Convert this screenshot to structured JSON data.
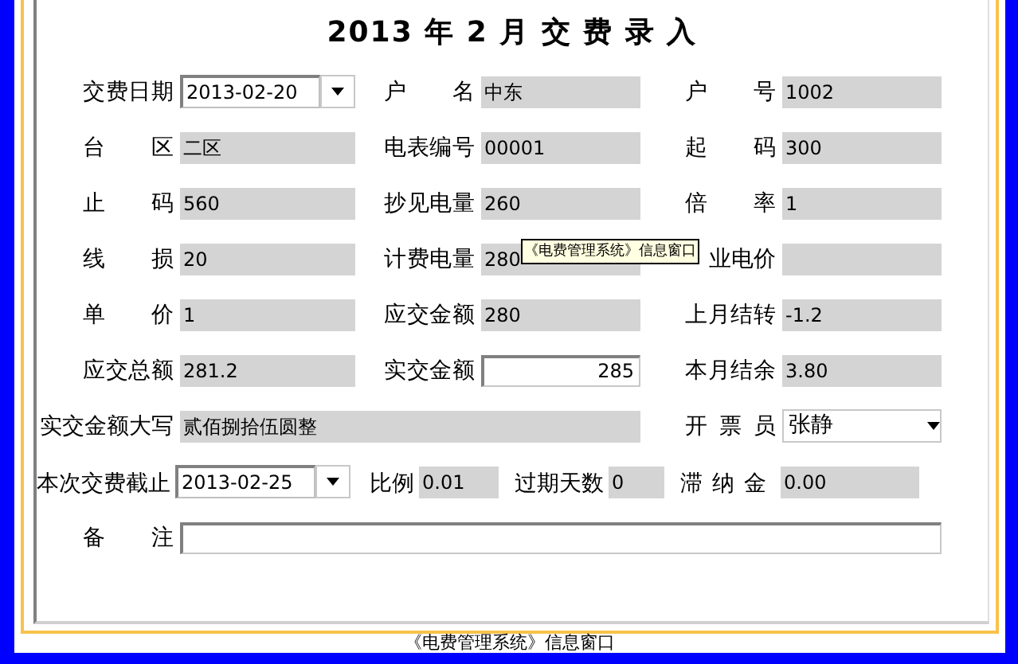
{
  "title": "2013 年 2 月 交 费 录 入",
  "rows": [
    {
      "kind": "grid",
      "fields": [
        {
          "label": "交费日期",
          "value": "2013-02-20",
          "kind": "date"
        },
        {
          "label": "户名",
          "value": "中东",
          "kind": "readonly"
        },
        {
          "label": "户号",
          "value": "1002",
          "kind": "readonly"
        }
      ]
    },
    {
      "kind": "grid",
      "fields": [
        {
          "label": "台区",
          "value": "二区",
          "kind": "readonly"
        },
        {
          "label": "电表编号",
          "value": "00001",
          "kind": "readonly"
        },
        {
          "label": "起码",
          "value": "300",
          "kind": "readonly"
        }
      ]
    },
    {
      "kind": "grid",
      "fields": [
        {
          "label": "止码",
          "value": "560",
          "kind": "readonly"
        },
        {
          "label": "抄见电量",
          "value": "260",
          "kind": "readonly"
        },
        {
          "label": "倍率",
          "value": "1",
          "kind": "readonly"
        }
      ]
    },
    {
      "kind": "grid",
      "fields": [
        {
          "label": "线损",
          "value": "20",
          "kind": "readonly"
        },
        {
          "label": "计费电量",
          "value": "280",
          "kind": "readonly"
        },
        {
          "label": "业电价",
          "kind": "readonly"
        }
      ]
    },
    {
      "kind": "grid",
      "fields": [
        {
          "label": "单价",
          "value": "1",
          "kind": "readonly"
        },
        {
          "label": "应交金额",
          "value": "280",
          "kind": "readonly"
        },
        {
          "label": "上月结转",
          "value": "-1.2",
          "kind": "readonly"
        }
      ]
    },
    {
      "kind": "grid",
      "fields": [
        {
          "label": "应交总额",
          "value": "281.2",
          "kind": "readonly"
        },
        {
          "label": "实交金额",
          "value": "285",
          "kind": "input"
        },
        {
          "label": "本月结余",
          "value": "3.80",
          "kind": "readonly"
        }
      ]
    },
    {
      "kind": "grid",
      "fields": [
        {
          "label": "实交金额大写",
          "value": "贰佰捌拾伍圆整",
          "kind": "wide"
        },
        {
          "label": "开票员",
          "value": "张静",
          "kind": "select"
        }
      ]
    },
    {
      "kind": "free",
      "fields": [
        {
          "label": "本次交费截止",
          "value": "2013-02-25",
          "kind": "date"
        },
        {
          "label": "比例",
          "value": "0.01",
          "kind": "readonly"
        },
        {
          "label": "过期天数",
          "value": "0",
          "kind": "readonly"
        },
        {
          "label": "滞纳金",
          "value": "0.00",
          "kind": "readonly"
        }
      ]
    },
    {
      "kind": "grid",
      "fields": [
        {
          "label": "备注",
          "kind": "memo"
        }
      ]
    }
  ],
  "tooltip": "《电费管理系统》信息窗口",
  "status_bar": "《电费管理系统》信息窗口"
}
